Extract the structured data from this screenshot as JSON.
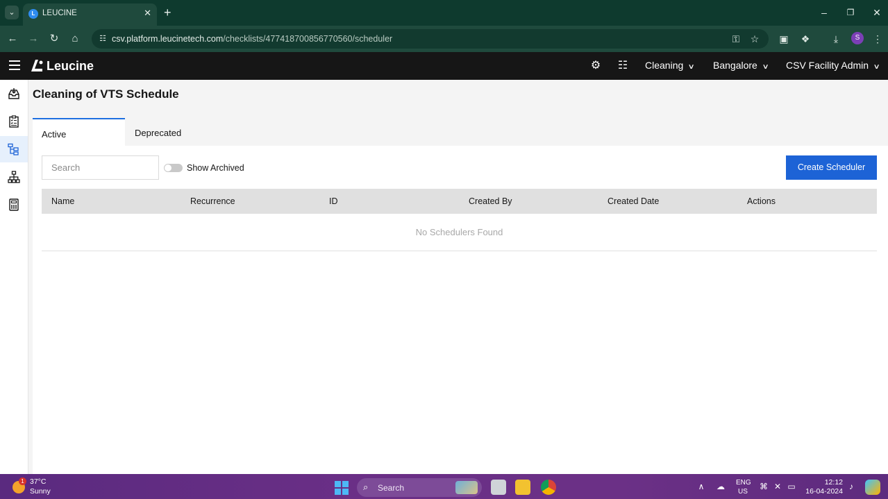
{
  "browser": {
    "tab_title": "LEUCINE",
    "tab_favicon_letter": "L",
    "url_host": "csv.platform.leucinetech.com",
    "url_path": "/checklists/477418700856770560/scheduler",
    "profile_initial": "S"
  },
  "app": {
    "brand": "Leucine",
    "use_case": "Cleaning",
    "facility": "Bangalore",
    "role": "CSV Facility Admin"
  },
  "sidebar": {
    "items": [
      {
        "icon": "inbox-icon"
      },
      {
        "icon": "checklist-icon"
      },
      {
        "icon": "ontology-icon",
        "active": true
      },
      {
        "icon": "hierarchy-icon"
      },
      {
        "icon": "reports-icon"
      }
    ]
  },
  "page": {
    "title": "Cleaning of VTS Schedule",
    "tabs": [
      {
        "label": "Active",
        "active": true
      },
      {
        "label": "Deprecated",
        "active": false
      }
    ],
    "search_placeholder": "Search",
    "show_archived_label": "Show Archived",
    "show_archived_on": false,
    "create_button": "Create Scheduler",
    "table": {
      "columns": [
        "Name",
        "Recurrence",
        "ID",
        "Created By",
        "Created Date",
        "Actions"
      ],
      "rows": [],
      "empty_text": "No Schedulers Found"
    }
  },
  "taskbar": {
    "temperature": "37°C",
    "weather": "Sunny",
    "weather_badge": "1",
    "search_label": "Search",
    "lang_line1": "ENG",
    "lang_line2": "US",
    "time": "12:12",
    "date": "16-04-2024"
  },
  "colors": {
    "accent": "#1d63d6",
    "header_bg": "#161616",
    "browser_frame": "#1f4a3d",
    "taskbar": "#6a2f86"
  }
}
